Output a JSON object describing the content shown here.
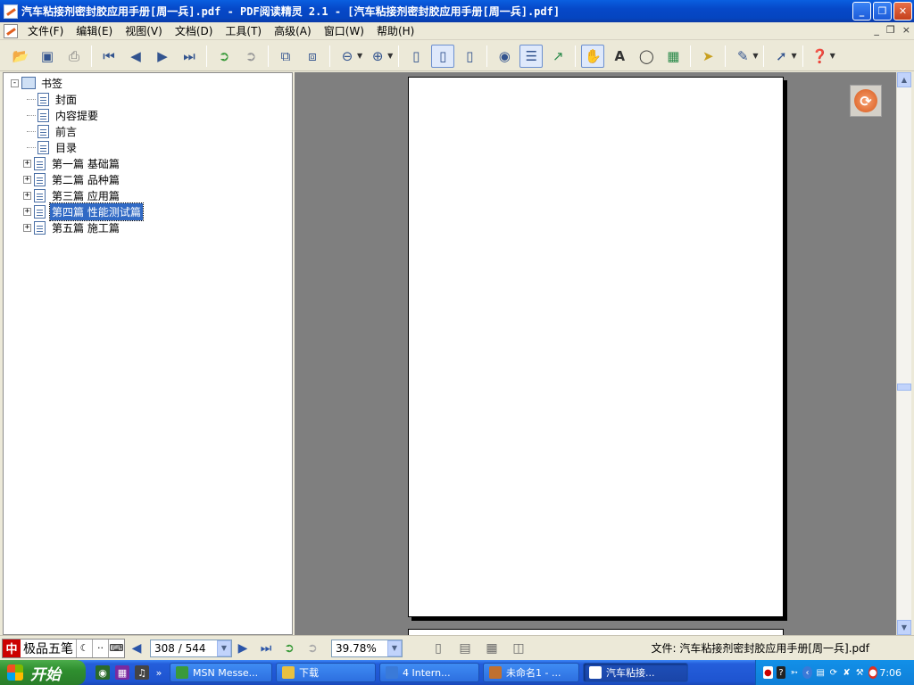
{
  "window": {
    "title": "汽车粘接剂密封胶应用手册[周一兵].pdf - PDF阅读精灵 2.1 - [汽车粘接剂密封胶应用手册[周一兵].pdf]",
    "minimize": "_",
    "maximize": "❐",
    "close": "✕"
  },
  "menu": {
    "items": [
      "文件(F)",
      "编辑(E)",
      "视图(V)",
      "文档(D)",
      "工具(T)",
      "高级(A)",
      "窗口(W)",
      "帮助(H)"
    ],
    "doc_controls": [
      "_",
      "❐",
      "×"
    ]
  },
  "toolbar": {
    "icons": [
      "open-icon",
      "save-icon",
      "print-icon",
      "first-page-icon",
      "previous-page-icon",
      "next-page-icon",
      "last-page-icon",
      "back-icon",
      "forward-icon",
      "extract-pages-icon",
      "insert-pages-icon",
      "zoom-out-icon",
      "zoom-in-icon",
      "actual-size-icon",
      "fit-page-icon",
      "fit-width-icon",
      "find-icon",
      "bookmarks-panel-icon",
      "export-icon",
      "hand-tool-icon",
      "text-select-icon",
      "snapshot-icon",
      "image-tool-icon",
      "select-arrow-icon",
      "annotation-icon",
      "link-arrow-icon",
      "help-icon"
    ]
  },
  "bookmarks": {
    "root": "书签",
    "items": [
      {
        "label": "封面",
        "expandable": false,
        "selected": false
      },
      {
        "label": "内容提要",
        "expandable": false,
        "selected": false
      },
      {
        "label": "前言",
        "expandable": false,
        "selected": false
      },
      {
        "label": "目录",
        "expandable": false,
        "selected": false
      },
      {
        "label": "第一篇 基础篇",
        "expandable": true,
        "selected": false
      },
      {
        "label": "第二篇 品种篇",
        "expandable": true,
        "selected": false
      },
      {
        "label": "第三篇 应用篇",
        "expandable": true,
        "selected": false
      },
      {
        "label": "第四篇 性能测试篇",
        "expandable": true,
        "selected": true
      },
      {
        "label": "第五篇 施工篇",
        "expandable": true,
        "selected": false
      }
    ]
  },
  "status": {
    "ime_name": "极品五笔",
    "page_indicator": "308 / 544",
    "zoom": "39.78%",
    "file_label": "文件: 汽车粘接剂密封胶应用手册[周一兵].pdf"
  },
  "taskbar": {
    "start": "开始",
    "tasks": [
      {
        "label": "MSN Messe...",
        "active": false,
        "color": "#3a9a3a"
      },
      {
        "label": "下载",
        "active": false,
        "color": "#e8c040"
      },
      {
        "label": "4 Intern...",
        "active": false,
        "color": "#3a7ad8"
      },
      {
        "label": "未命名1 - ...",
        "active": false,
        "color": "#c07030"
      },
      {
        "label": "汽车粘接...",
        "active": true,
        "color": "#ffffff"
      }
    ],
    "clock": "7:06"
  },
  "colors": {
    "title_bar": "#0a5fe0",
    "selection": "#316ac5",
    "viewer_bg": "#7f7f7f",
    "taskbar": "#245edb",
    "start_button": "#2f8f2f"
  }
}
